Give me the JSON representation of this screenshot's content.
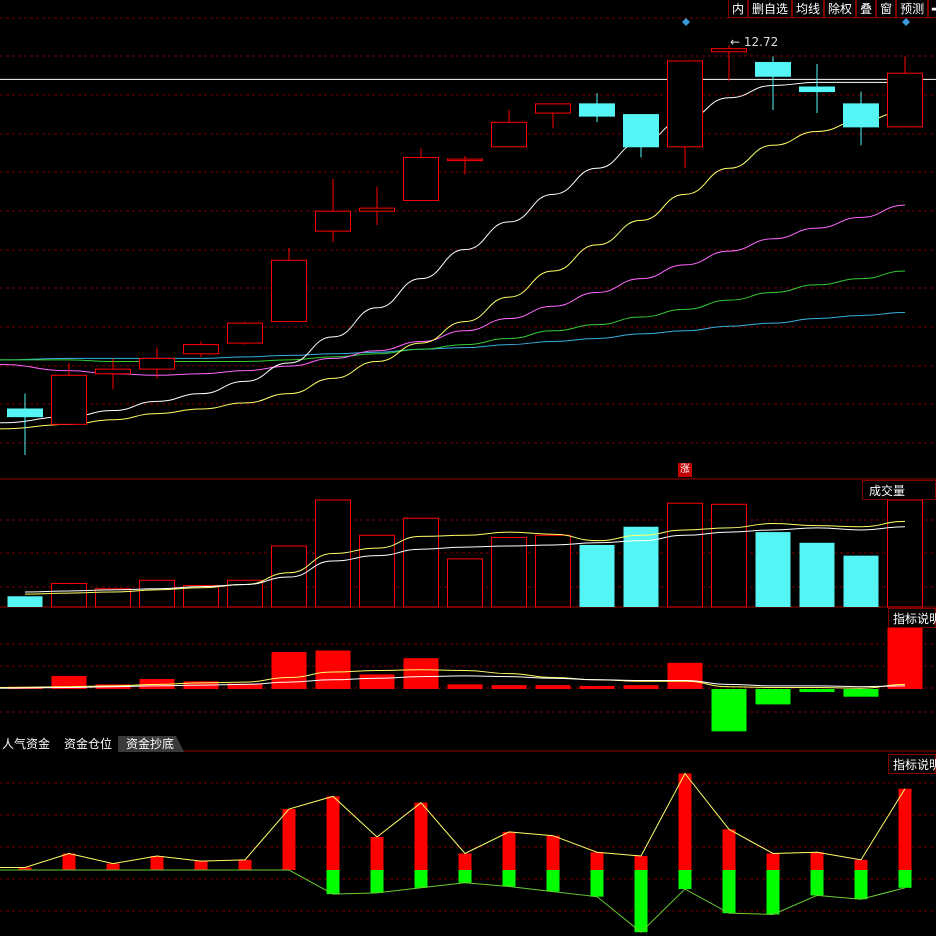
{
  "toolbar": {
    "items": [
      "内",
      "删自选",
      "均线",
      "除权",
      "叠",
      "窗",
      "预测",
      "➡"
    ]
  },
  "price_chart": {
    "max_label": "12.72",
    "max_arrow": "←",
    "candles_up_color": "#ff3030",
    "candles_down_color": "#55f5f5"
  },
  "volume_panel": {
    "title": "成交量",
    "zhang_label": "涨"
  },
  "indicator_panel_1": {
    "title": "指标说明"
  },
  "indicator_panel_2": {
    "title": "指标说明"
  },
  "tabs": [
    "人气资金",
    "资金仓位",
    "资金抄底"
  ],
  "colors": {
    "grid": "#7a0000",
    "ma5": "#ffffff",
    "ma10": "#ffff66",
    "ma20": "#ff66ff",
    "ma30": "#33cc33",
    "ma60": "#3ab0e0",
    "up": "#ff0000",
    "down": "#00ff00",
    "cyan": "#55f5f5"
  },
  "chart_data": {
    "type": "candlestick",
    "candles": [
      {
        "o": 10.35,
        "h": 10.45,
        "l": 10.05,
        "c": 10.3
      },
      {
        "o": 10.25,
        "h": 10.65,
        "l": 10.25,
        "c": 10.57
      },
      {
        "o": 10.58,
        "h": 10.68,
        "l": 10.48,
        "c": 10.61
      },
      {
        "o": 10.61,
        "h": 10.75,
        "l": 10.55,
        "c": 10.68
      },
      {
        "o": 10.71,
        "h": 10.79,
        "l": 10.69,
        "c": 10.77
      },
      {
        "o": 10.78,
        "h": 10.92,
        "l": 10.77,
        "c": 10.91
      },
      {
        "o": 10.92,
        "h": 11.4,
        "l": 10.92,
        "c": 11.32
      },
      {
        "o": 11.51,
        "h": 11.85,
        "l": 11.44,
        "c": 11.64
      },
      {
        "o": 11.64,
        "h": 11.8,
        "l": 11.55,
        "c": 11.66
      },
      {
        "o": 11.71,
        "h": 12.05,
        "l": 11.71,
        "c": 11.99
      },
      {
        "o": 11.97,
        "h": 12.0,
        "l": 11.88,
        "c": 11.98
      },
      {
        "o": 12.06,
        "h": 12.3,
        "l": 12.06,
        "c": 12.22
      },
      {
        "o": 12.28,
        "h": 12.33,
        "l": 12.18,
        "c": 12.34
      },
      {
        "o": 12.34,
        "h": 12.41,
        "l": 12.22,
        "c": 12.26
      },
      {
        "o": 12.27,
        "h": 12.27,
        "l": 11.99,
        "c": 12.06
      },
      {
        "o": 12.06,
        "h": 12.62,
        "l": 11.92,
        "c": 12.62
      },
      {
        "o": 12.68,
        "h": 12.72,
        "l": 12.49,
        "c": 12.7
      },
      {
        "o": 12.61,
        "h": 12.65,
        "l": 12.3,
        "c": 12.52
      },
      {
        "o": 12.45,
        "h": 12.6,
        "l": 12.28,
        "c": 12.42
      },
      {
        "o": 12.34,
        "h": 12.42,
        "l": 12.07,
        "c": 12.19
      },
      {
        "o": 12.19,
        "h": 12.65,
        "l": 12.19,
        "c": 12.54
      }
    ],
    "ma_white": [
      10.26,
      10.3,
      10.34,
      10.4,
      10.45,
      10.53,
      10.65,
      10.82,
      11.01,
      11.2,
      11.39,
      11.57,
      11.75,
      11.92,
      12.09,
      12.24,
      12.38,
      12.46,
      12.48,
      12.48,
      12.48
    ],
    "ma_yellow": [
      10.22,
      10.25,
      10.28,
      10.32,
      10.35,
      10.39,
      10.45,
      10.55,
      10.66,
      10.78,
      10.92,
      11.08,
      11.25,
      11.42,
      11.58,
      11.75,
      11.92,
      12.07,
      12.16,
      12.23,
      12.29
    ],
    "ma_magenta": [
      10.64,
      10.6,
      10.58,
      10.57,
      10.58,
      10.6,
      10.63,
      10.68,
      10.73,
      10.79,
      10.86,
      10.94,
      11.02,
      11.11,
      11.2,
      11.29,
      11.38,
      11.46,
      11.53,
      11.6,
      11.68
    ],
    "ma_green": [
      10.67,
      10.67,
      10.66,
      10.66,
      10.66,
      10.66,
      10.67,
      10.69,
      10.71,
      10.74,
      10.77,
      10.81,
      10.86,
      10.9,
      10.95,
      11.0,
      11.06,
      11.11,
      11.16,
      11.2,
      11.25
    ],
    "ma_blue": [
      10.67,
      10.68,
      10.68,
      10.68,
      10.68,
      10.69,
      10.7,
      10.71,
      10.72,
      10.74,
      10.75,
      10.77,
      10.79,
      10.81,
      10.84,
      10.86,
      10.89,
      10.91,
      10.94,
      10.96,
      10.98
    ],
    "hline": 12.5,
    "volume": [
      10,
      22,
      17,
      25,
      20,
      25,
      57,
      100,
      67,
      83,
      45,
      65,
      67,
      58,
      75,
      97,
      96,
      70,
      60,
      48,
      100
    ],
    "vol_ma_white": [
      14,
      15,
      16,
      17,
      19,
      21,
      28,
      43,
      48,
      54,
      56,
      57,
      58,
      60,
      62,
      67,
      70,
      72,
      74,
      72,
      75
    ],
    "vol_ma_yellow": [
      12,
      13,
      14,
      16,
      18,
      21,
      32,
      50,
      55,
      66,
      67,
      70,
      68,
      62,
      67,
      72,
      74,
      78,
      76,
      75,
      80
    ],
    "ind1": [
      0.3,
      1.7,
      0.6,
      1.3,
      1.0,
      0.7,
      4.8,
      5.0,
      1.9,
      4.0,
      0.6,
      0.5,
      0.5,
      0.4,
      0.5,
      3.4,
      -5.5,
      -2.0,
      -0.4,
      -1.0,
      8.0
    ],
    "ind1_yellow": [
      0.2,
      0.3,
      0.4,
      0.6,
      0.8,
      0.9,
      1.5,
      2.2,
      2.4,
      2.5,
      2.4,
      2.0,
      1.5,
      1.2,
      1.0,
      1.0,
      0.3,
      0.2,
      0.2,
      0.1,
      0.6
    ],
    "ind1_white": [
      0.1,
      0.2,
      0.3,
      0.4,
      0.5,
      0.6,
      0.9,
      1.2,
      1.4,
      1.6,
      1.7,
      1.6,
      1.4,
      1.2,
      1.1,
      1.1,
      0.6,
      0.4,
      0.4,
      0.3,
      0.4
    ],
    "ind2_pos": [
      0.2,
      1.3,
      0.5,
      1.1,
      0.7,
      0.8,
      4.8,
      5.8,
      2.6,
      5.3,
      1.3,
      3.0,
      2.7,
      1.4,
      1.1,
      7.6,
      3.2,
      1.3,
      1.4,
      0.8,
      6.4
    ],
    "ind2_neg": [
      0,
      0,
      0,
      0,
      0,
      0,
      0,
      -1.9,
      -1.8,
      -1.4,
      -1.0,
      -1.3,
      -1.7,
      -2.1,
      -4.9,
      -1.5,
      -3.4,
      -3.5,
      -2.0,
      -2.3,
      -1.4
    ]
  }
}
